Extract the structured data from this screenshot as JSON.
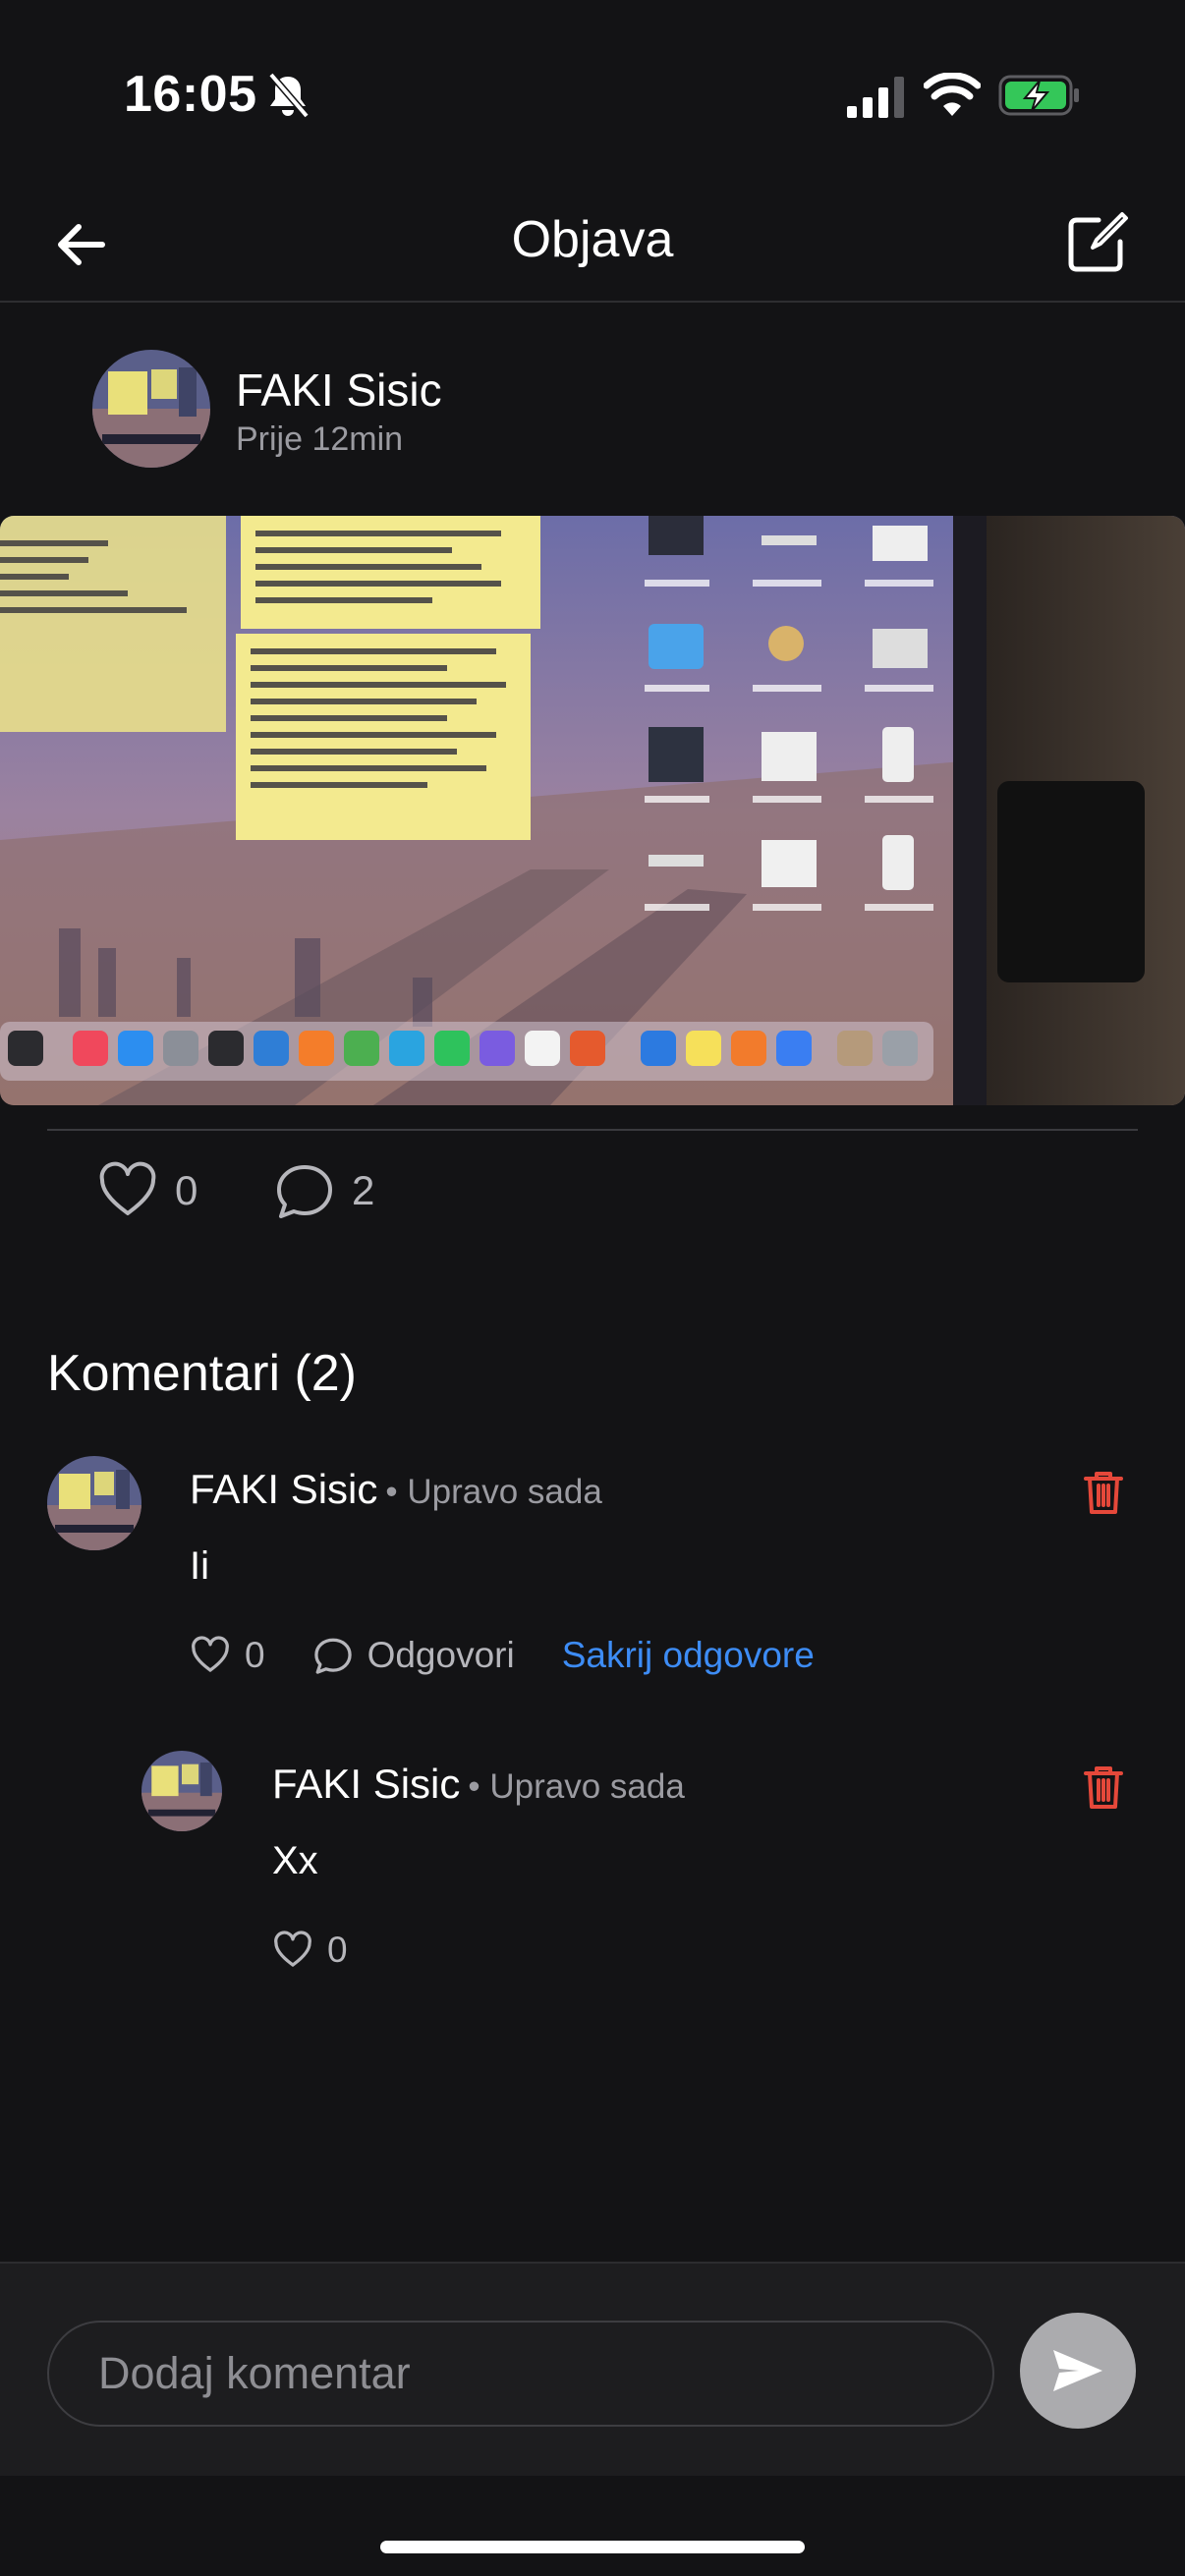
{
  "status_bar": {
    "time": "16:05",
    "icons": [
      "bell-slash-icon",
      "signal-icon",
      "wifi-icon",
      "battery-charging-icon"
    ]
  },
  "nav": {
    "title": "Objava",
    "back_icon": "arrow-left-icon",
    "edit_icon": "edit-square-icon"
  },
  "post": {
    "author": "FAKI Sisic",
    "time": "Prije 12min",
    "likes": "0",
    "comments": "2",
    "like_icon": "heart-icon",
    "comment_icon": "speech-bubble-icon"
  },
  "comments_section": {
    "title": "Komentari (2)",
    "comments": [
      {
        "author": "FAKI Sisic",
        "time": "• Upravo sada",
        "text": "Ii",
        "likes": "0",
        "reply_label": "Odgovori",
        "hide_replies_label": "Sakrij odgovore",
        "replies": [
          {
            "author": "FAKI Sisic",
            "time": "• Upravo sada",
            "text": "Xx",
            "likes": "0"
          }
        ]
      }
    ]
  },
  "composer": {
    "placeholder": "Dodaj komentar",
    "send_icon": "send-icon"
  },
  "colors": {
    "background": "#131315",
    "accent_link": "#3d8cf5",
    "delete": "#e5483a",
    "battery_charging": "#34c759"
  }
}
